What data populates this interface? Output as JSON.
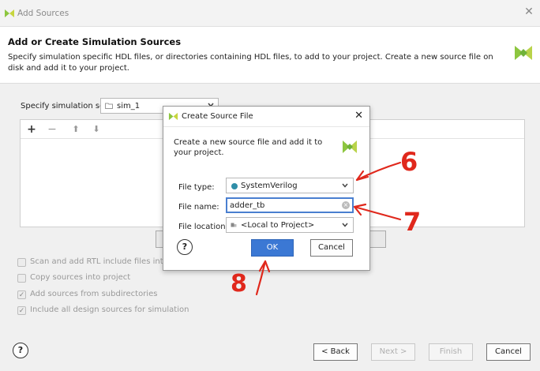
{
  "window": {
    "title": "Add Sources"
  },
  "header": {
    "title": "Add or Create Simulation Sources",
    "description": "Specify simulation specific HDL files, or directories containing HDL files, to add to your project. Create a new source file on disk and add it to your project."
  },
  "sim_set": {
    "label": "Specify simulation set:",
    "value": "sim_1"
  },
  "options": [
    {
      "label": "Scan and add RTL include files into pro",
      "checked": false
    },
    {
      "label": "Copy sources into project",
      "checked": false
    },
    {
      "label": "Add sources from subdirectories",
      "checked": true
    },
    {
      "label": "Include all design sources for simulation",
      "checked": true
    }
  ],
  "footer": {
    "help": "?",
    "back": "< Back",
    "next": "Next >",
    "finish": "Finish",
    "cancel": "Cancel"
  },
  "dialog": {
    "title": "Create Source File",
    "description": "Create a new source file and add it to your project.",
    "file_type": {
      "label": "File type:",
      "value": "SystemVerilog"
    },
    "file_name": {
      "label": "File name:",
      "value": "adder_tb"
    },
    "file_location": {
      "label": "File location:",
      "value": "<Local to Project>"
    },
    "help": "?",
    "ok": "OK",
    "cancel": "Cancel"
  },
  "annotations": {
    "n6": "6",
    "n7": "7",
    "n8": "8"
  },
  "colors": {
    "primary_button": "#3b78d4",
    "annotation": "#e0281c",
    "logo_green": "#8dc63f"
  }
}
